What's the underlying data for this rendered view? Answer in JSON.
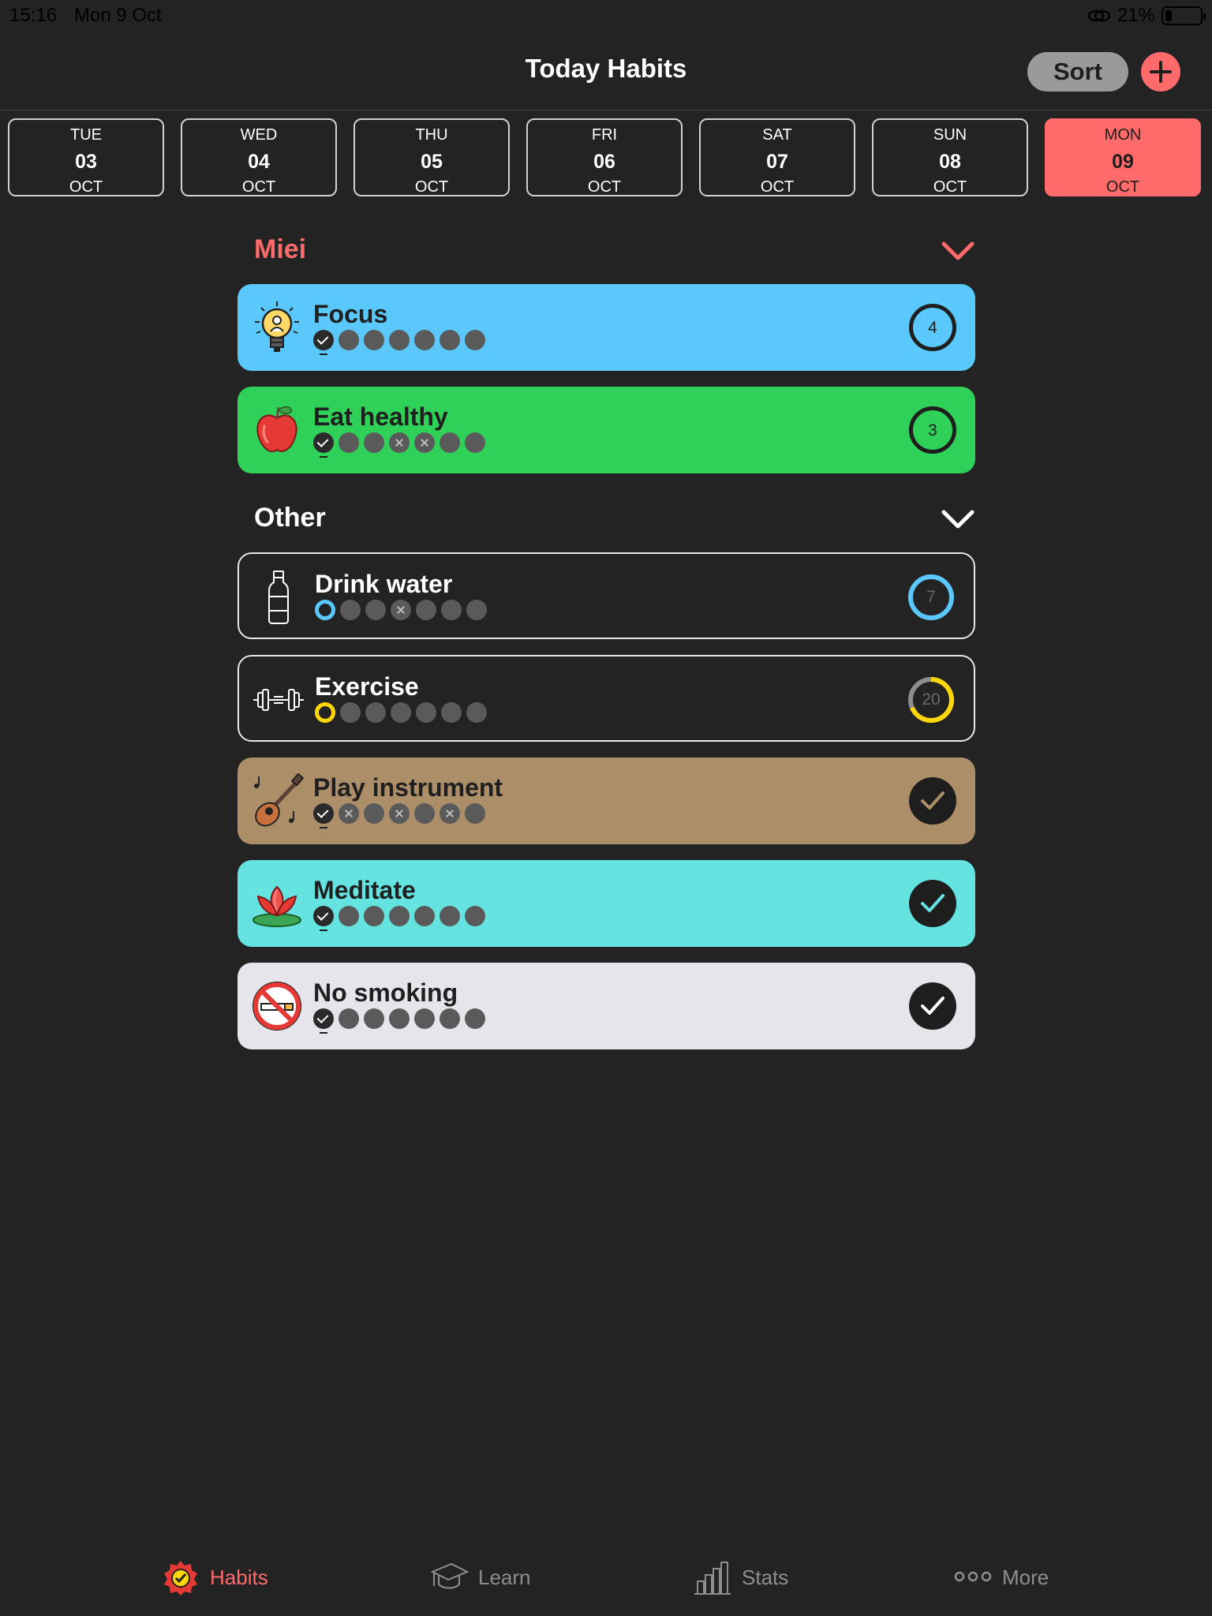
{
  "status": {
    "time": "15:16",
    "date": "Mon 9 Oct",
    "battery": "21%"
  },
  "header": {
    "title": "Today Habits",
    "sort_label": "Sort"
  },
  "days": [
    {
      "name": "TUE",
      "num": "03",
      "month": "OCT"
    },
    {
      "name": "WED",
      "num": "04",
      "month": "OCT"
    },
    {
      "name": "THU",
      "num": "05",
      "month": "OCT"
    },
    {
      "name": "FRI",
      "num": "06",
      "month": "OCT"
    },
    {
      "name": "SAT",
      "num": "07",
      "month": "OCT"
    },
    {
      "name": "SUN",
      "num": "08",
      "month": "OCT"
    },
    {
      "name": "MON",
      "num": "09",
      "month": "OCT"
    }
  ],
  "sections": [
    {
      "title": "Miei",
      "color": "#ff6b6b"
    },
    {
      "title": "Other",
      "color": "#ffffff"
    }
  ],
  "habits": [
    {
      "name": "Focus",
      "icon": "lightbulb-icon",
      "color": "#5ac8fa",
      "badge": "4",
      "days": [
        "check",
        "empty",
        "empty",
        "empty",
        "empty",
        "empty",
        "empty"
      ]
    },
    {
      "name": "Eat healthy",
      "icon": "apple-icon",
      "color": "#30d158",
      "badge": "3",
      "days": [
        "check",
        "empty",
        "empty",
        "cross",
        "cross",
        "empty",
        "empty"
      ]
    },
    {
      "name": "Drink water",
      "icon": "water-bottle-icon",
      "color": "transparent",
      "badge": "7",
      "progress_color": "#5ac8fa",
      "days": [
        "ring",
        "empty",
        "empty",
        "cross",
        "empty",
        "empty",
        "empty"
      ]
    },
    {
      "name": "Exercise",
      "icon": "dumbbell-icon",
      "color": "transparent",
      "badge": "20",
      "progress_color": "#ffd60a",
      "days": [
        "ring",
        "empty",
        "empty",
        "empty",
        "empty",
        "empty",
        "empty"
      ]
    },
    {
      "name": "Play instrument",
      "icon": "guitar-icon",
      "color": "#ac8e68",
      "badge": "done",
      "check_color": "#ac8e68",
      "days": [
        "check",
        "cross",
        "empty",
        "cross",
        "empty",
        "cross",
        "empty"
      ]
    },
    {
      "name": "Meditate",
      "icon": "lotus-icon",
      "color": "#64e3e1",
      "badge": "done",
      "check_color": "#64e3e1",
      "days": [
        "check",
        "empty",
        "empty",
        "empty",
        "empty",
        "empty",
        "empty"
      ]
    },
    {
      "name": "No smoking",
      "icon": "no-smoking-icon",
      "color": "#e6e5ec",
      "badge": "done",
      "check_color": "#ffffff",
      "days": [
        "check",
        "empty",
        "empty",
        "empty",
        "empty",
        "empty",
        "empty"
      ]
    }
  ],
  "tabs": [
    {
      "label": "Habits",
      "icon": "habits-badge-icon"
    },
    {
      "label": "Learn",
      "icon": "graduation-cap-icon"
    },
    {
      "label": "Stats",
      "icon": "stats-chart-icon"
    },
    {
      "label": "More",
      "icon": "more-dots-icon"
    }
  ],
  "accent": "#ff6b6b"
}
